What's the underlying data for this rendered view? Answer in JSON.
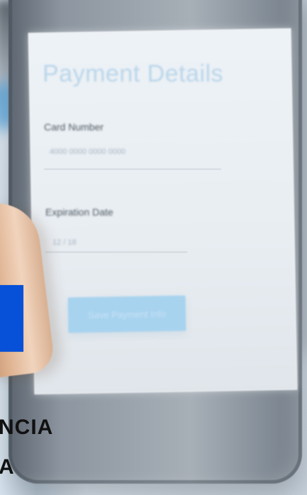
{
  "screen": {
    "title": "Payment Details",
    "card_label": "Card Number",
    "card_value": "4000 0000 0000 0000",
    "expiration_label": "Expiration Date",
    "expiration_value": "12 / 18",
    "button_label": "Save Payment Info"
  },
  "overlay": {
    "line_1": "NCIA",
    "line_2": "A"
  },
  "colors": {
    "blue_tab": "#0751d9",
    "title": "#b9d5ea",
    "button": "#a8d3ef"
  }
}
